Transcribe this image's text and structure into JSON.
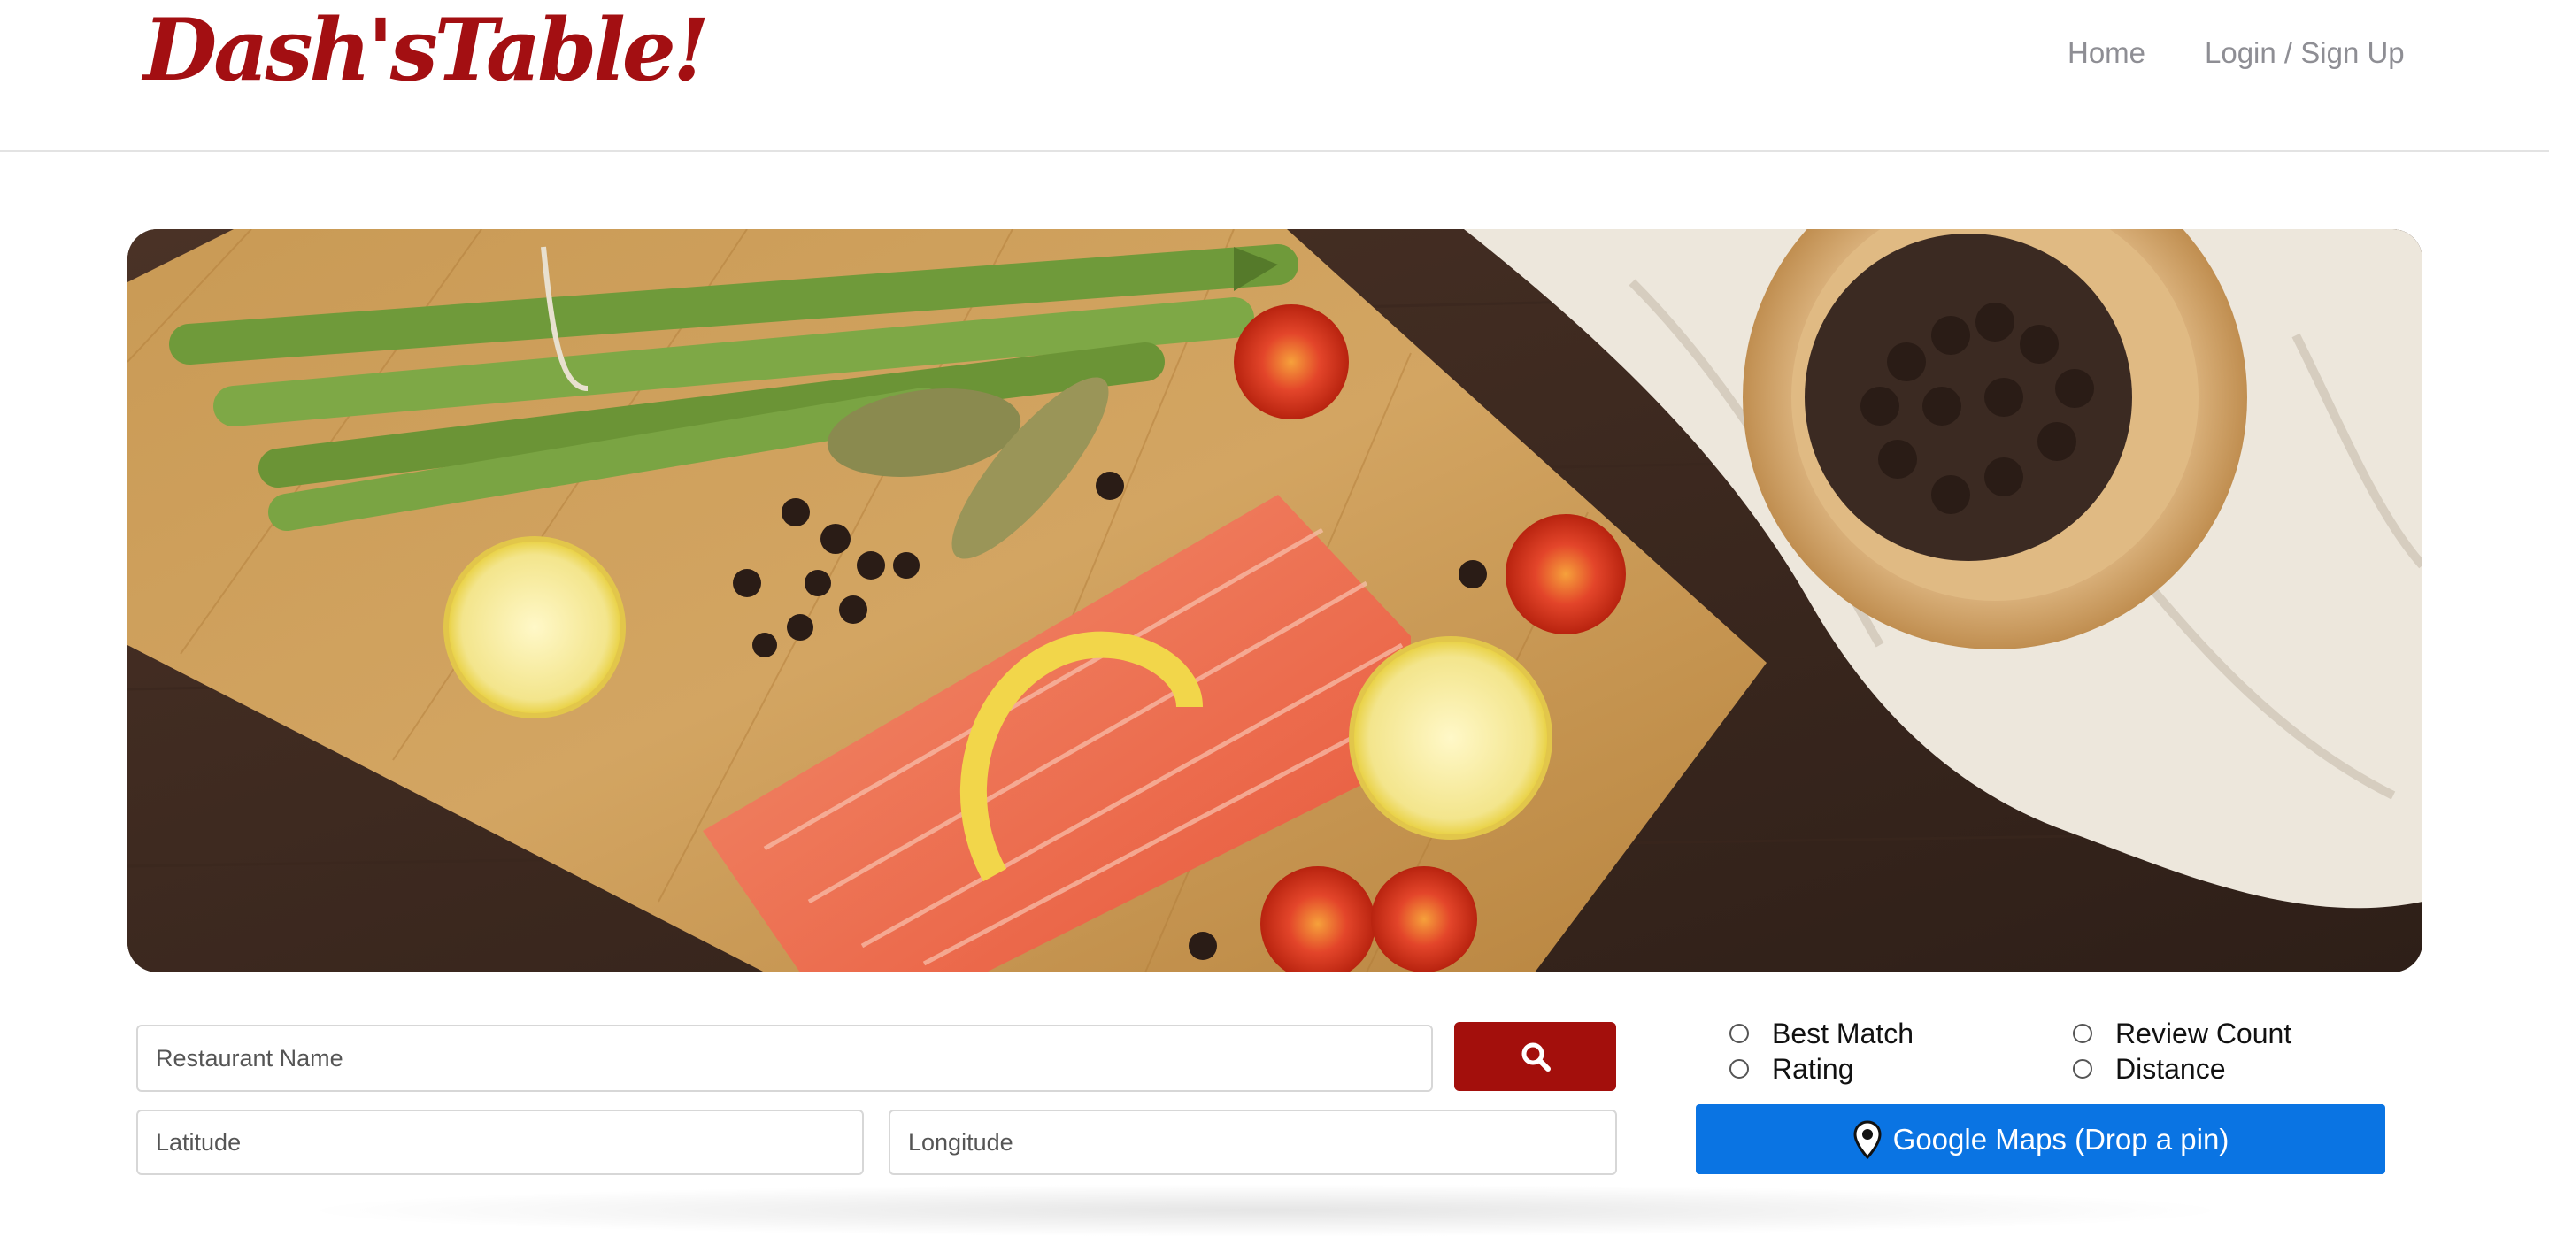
{
  "header": {
    "brand": "Dash'sTable!",
    "nav": {
      "home": "Home",
      "login": "Login / Sign Up"
    }
  },
  "search": {
    "name_placeholder": "Restaurant Name",
    "latitude_placeholder": "Latitude",
    "longitude_placeholder": "Longitude"
  },
  "sort_options": {
    "best_match": "Best Match",
    "review_count": "Review Count",
    "rating": "Rating",
    "distance": "Distance"
  },
  "maps_button": {
    "label": "Google Maps (Drop a pin)"
  },
  "icons": {
    "search": "search-icon",
    "map_pin": "map-pin-icon"
  },
  "colors": {
    "brand": "#a30f12",
    "search_button": "#a30f0c",
    "maps_button": "#0a74e3",
    "nav_link": "#8e8e94"
  }
}
